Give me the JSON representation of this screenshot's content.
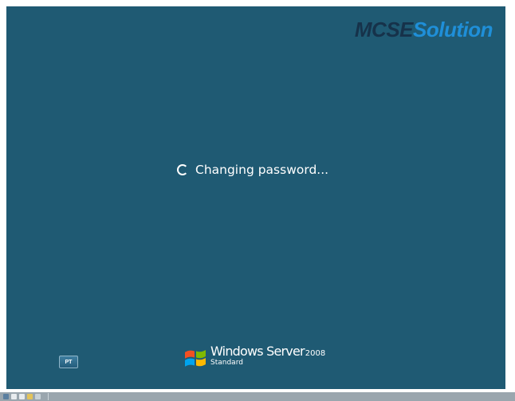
{
  "watermark": {
    "part1": "MCSE",
    "part2": "Solution"
  },
  "status": {
    "icon": "spinner-icon",
    "text": "Changing password..."
  },
  "language_button": {
    "label": "PT"
  },
  "branding": {
    "product": "Windows Server",
    "version": "2008",
    "edition": "Standard"
  },
  "taskbar": {
    "icons": [
      "start-icon",
      "app-icon",
      "app-icon",
      "folder-icon",
      "arrow-icon"
    ]
  },
  "colors": {
    "background": "#1f5a73",
    "text": "#ffffff",
    "watermark_dark": "#16324a",
    "watermark_blue": "#1f8fd8"
  }
}
